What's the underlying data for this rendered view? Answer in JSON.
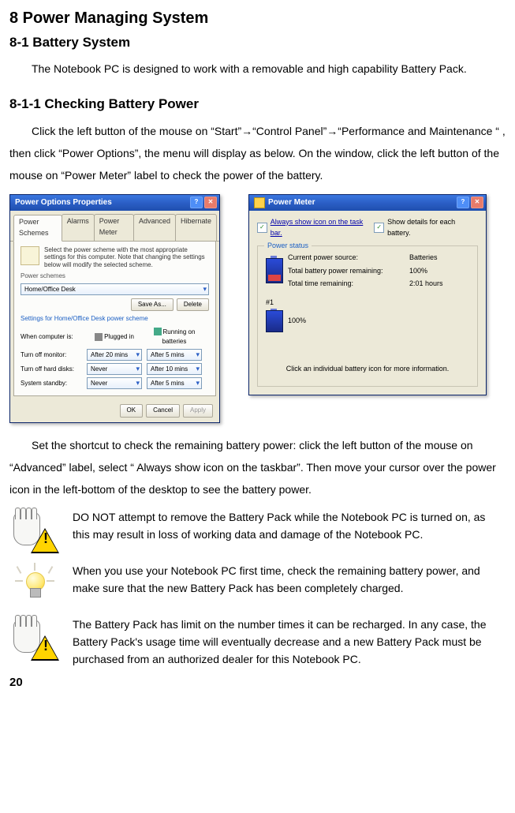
{
  "headings": {
    "h1": "8 Power Managing System",
    "h2": "8-1 Battery System",
    "h3": "8-1-1 Checking Battery Power"
  },
  "paragraphs": {
    "p1": "The Notebook PC is designed to work with a removable and high capability Battery Pack.",
    "p2": "Click the left button of the mouse on “Start”→“Control Panel”→“Performance and Maintenance “ , then click “Power Options”, the menu will display as below. On the window, click the left button of the mouse on “Power Meter” label to check the power of the battery.",
    "p3": "Set the shortcut to check the remaining battery power: click the left button of the mouse on “Advanced” label, select “ Always show icon on the taskbar”. Then move your cursor over the power icon in the left-bottom of the desktop to see the battery power."
  },
  "power_options": {
    "title": "Power Options Properties",
    "tabs": [
      "Power Schemes",
      "Alarms",
      "Power Meter",
      "Advanced",
      "Hibernate"
    ],
    "note": "Select the power scheme with the most appropriate settings for this computer. Note that changing the settings below will modify the selected scheme.",
    "schemes_label": "Power schemes",
    "scheme_value": "Home/Office Desk",
    "save_as": "Save As...",
    "delete": "Delete",
    "settings_label": "Settings for Home/Office Desk power scheme",
    "col_label": "When computer is:",
    "col_plugged": "Plugged in",
    "col_battery": "Running on batteries",
    "rows": {
      "monitor_label": "Turn off monitor:",
      "monitor_plugged": "After 20 mins",
      "monitor_batt": "After 5 mins",
      "disks_label": "Turn off hard disks:",
      "disks_plugged": "Never",
      "disks_batt": "After 10 mins",
      "standby_label": "System standby:",
      "standby_plugged": "Never",
      "standby_batt": "After 5 mins"
    },
    "ok": "OK",
    "cancel": "Cancel",
    "apply": "Apply"
  },
  "power_meter": {
    "title": "Power Meter",
    "always_show": "Always show icon on the task bar.",
    "show_details": "Show details for each battery.",
    "legend": "Power status",
    "cps_label": "Current power source:",
    "cps_value": "Batteries",
    "tbpr_label": "Total battery power remaining:",
    "tbpr_value": "100%",
    "ttr_label": "Total time remaining:",
    "ttr_value": "2:01 hours",
    "batt_num": "#1",
    "batt_pct": "100%",
    "footer": "Click an individual battery icon for more information."
  },
  "notes": {
    "warn1": "DO NOT attempt to remove the Battery Pack while the Notebook PC is turned on, as this may result in loss of working data and damage of the Notebook PC.",
    "tip": "When you use your Notebook PC first time, check the remaining battery power, and make sure that the new Battery Pack has been completely charged.",
    "warn2": "The Battery Pack has limit on the number times it can be recharged. In any case, the Battery Pack's usage time will eventually decrease and a new Battery Pack must be purchased from an authorized dealer for this Notebook PC."
  },
  "page_number": "20"
}
